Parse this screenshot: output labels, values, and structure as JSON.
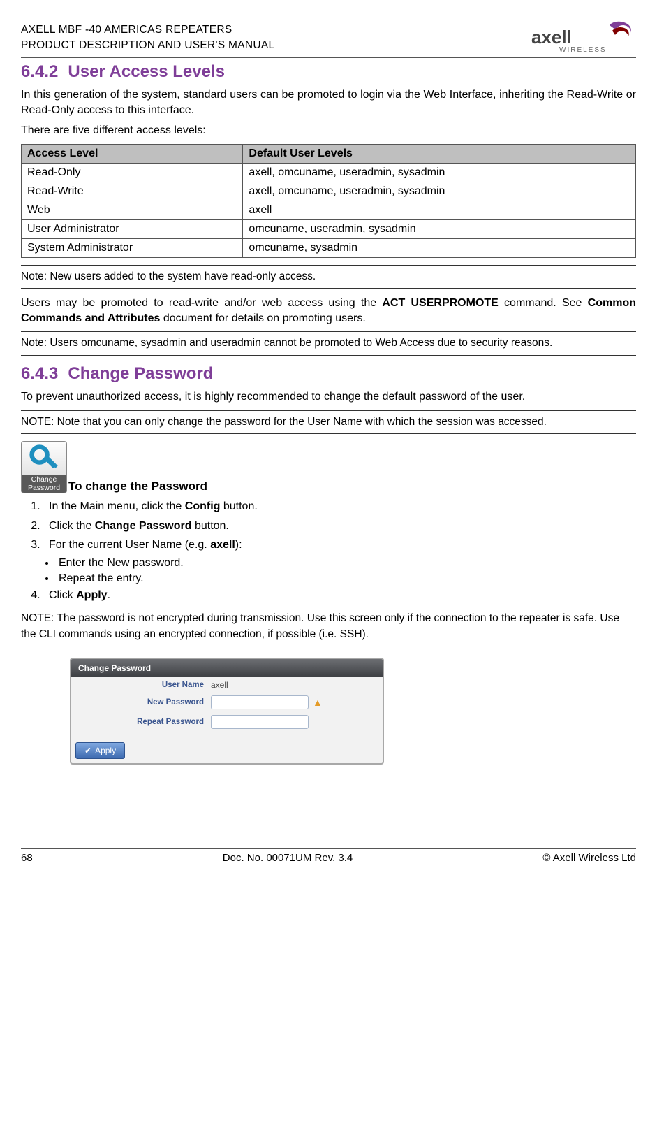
{
  "header": {
    "line1": "AXELL MBF -40 AMERICAS REPEATERS",
    "line2": "PRODUCT DESCRIPTION AND USER'S MANUAL",
    "brand_top": "axell",
    "brand_bottom": "WIRELESS"
  },
  "section1": {
    "number": "6.4.2",
    "title": "User Access Levels",
    "p1": "In this generation of the system, standard users can be promoted to login via the Web Interface, inheriting the Read-Write or Read-Only access to this interface.",
    "p2": "There are five different access levels:"
  },
  "table": {
    "h1": "Access Level",
    "h2": "Default User Levels",
    "rows": [
      {
        "c1": "Read-Only",
        "c2": "axell, omcuname, useradmin, sysadmin"
      },
      {
        "c1": "Read-Write",
        "c2": "axell, omcuname, useradmin, sysadmin"
      },
      {
        "c1": "Web",
        "c2": "axell"
      },
      {
        "c1": "User Administrator",
        "c2": "omcuname, useradmin, sysadmin"
      },
      {
        "c1": "System Administrator",
        "c2": "omcuname, sysadmin"
      }
    ]
  },
  "note1": "Note: New users added to the system have read-only access.",
  "promote": {
    "pre": "Users may be promoted to read-write and/or web access using the ",
    "cmd": "ACT USERPROMOTE",
    "mid": " command. See ",
    "doc": "Common Commands and Attributes",
    "post": " document for details on promoting users."
  },
  "note2": "Note: Users omcuname, sysadmin and useradmin cannot be promoted to Web Access due to security reasons.",
  "section2": {
    "number": "6.4.3",
    "title": "Change Password",
    "p1": "To prevent unauthorized access, it is highly recommended to change the default password of the user."
  },
  "note3": "NOTE: Note that you can only change the password for the User Name with which the session was accessed.",
  "icon": {
    "label_line1": "Change",
    "label_line2": "Password",
    "title": "To change the Password"
  },
  "steps": {
    "s1a": "In the Main menu, click the ",
    "s1b": "Config",
    "s1c": " button.",
    "s2a": "Click the ",
    "s2b": "Change Password",
    "s2c": " button.",
    "s3a": "For the current User Name (e.g. ",
    "s3b": "axell",
    "s3c": "):",
    "b1": "Enter the New password.",
    "b2": "Repeat the entry.",
    "s4a": "Click ",
    "s4b": "Apply",
    "s4c": "."
  },
  "note4": "NOTE: The password is not encrypted during transmission. Use this screen only if the connection to the repeater is safe. Use the CLI commands using an encrypted connection, if possible (i.e. SSH).",
  "dialog": {
    "title": "Change Password",
    "row1_label": "User Name",
    "row1_value": "axell",
    "row2_label": "New Password",
    "row3_label": "Repeat Password",
    "apply": "Apply"
  },
  "footer": {
    "page": "68",
    "doc": "Doc. No. 00071UM Rev. 3.4",
    "copyright": "© Axell Wireless Ltd"
  }
}
